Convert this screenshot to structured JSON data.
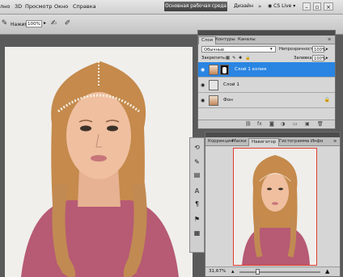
{
  "menubar": {
    "items": [
      "лно",
      "3D",
      "Просмотр",
      "Окно",
      "Справка"
    ],
    "workspace_button": "Основная рабочая среда",
    "design_link": "Дизайн",
    "cs_live": "CS Live"
  },
  "options": {
    "pressure_label": "Нажим:",
    "pressure_value": "100%"
  },
  "layers_panel": {
    "tabs": [
      "Слои",
      "Контуры",
      "Каналы"
    ],
    "blend_mode": "Обычные",
    "opacity_label": "Непрозрачность:",
    "opacity_value": "100%",
    "lock_label": "Закрепить:",
    "fill_label": "Заливка:",
    "fill_value": "100%",
    "layers": [
      {
        "name": "Слой 1 копия",
        "selected": true
      },
      {
        "name": "Слой 1",
        "selected": false
      },
      {
        "name": "Фон",
        "selected": false
      }
    ]
  },
  "navigator_panel": {
    "tabs": [
      "Коррекция",
      "Маски",
      "Навигатор",
      "Гистограмма",
      "Инфо"
    ],
    "zoom_value": "31,67%"
  },
  "colors": {
    "selection": "#2a85e2",
    "nav_frame": "#e53d2f"
  }
}
